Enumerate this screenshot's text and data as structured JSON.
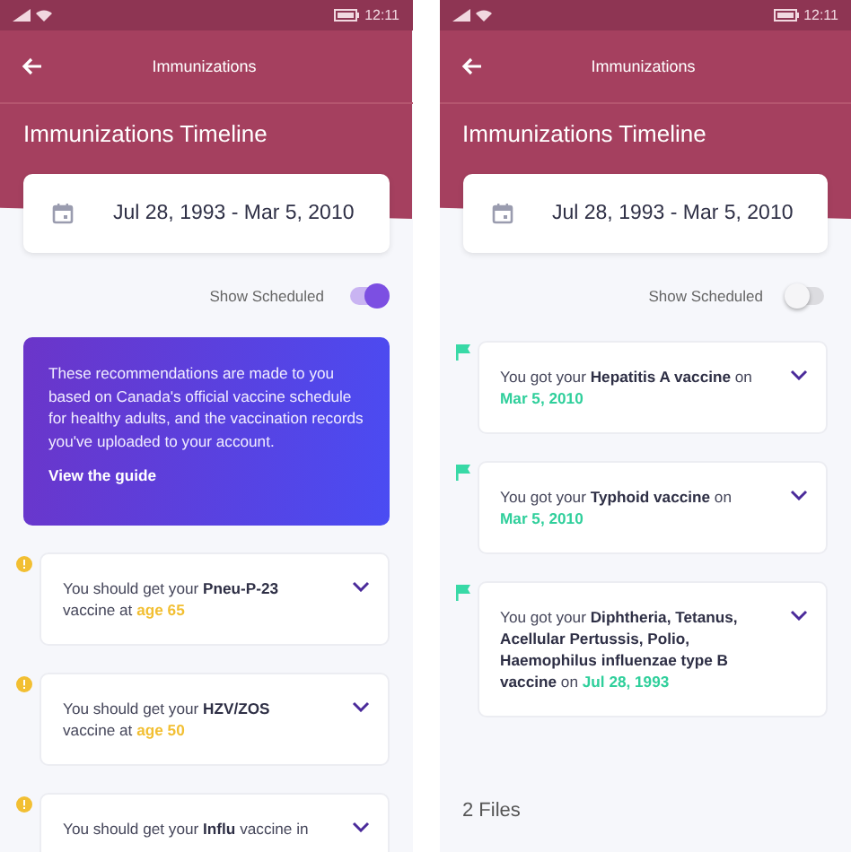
{
  "screens": [
    {
      "status_bar": {
        "time": "12:11"
      },
      "nav": {
        "title": "Immunizations"
      },
      "page_title": "Immunizations Timeline",
      "date_range": "Jul 28, 1993 - Mar 5, 2010",
      "toggle": {
        "label": "Show Scheduled",
        "on": true
      },
      "banner": {
        "text": "These recommendations are made to you based on Canada's official vaccine schedule for healthy adults, and the vaccination records you've uploaded to your account.",
        "link": "View the guide"
      },
      "entries": [
        {
          "kind": "scheduled",
          "text": "You should get your **Pneu-P-23** vaccine at",
          "highlight": "age 65"
        },
        {
          "kind": "scheduled",
          "text": "You should get your **HZV/ZOS** vaccine at",
          "highlight": "age 50"
        },
        {
          "kind": "scheduled",
          "text": "You should get your **Influ** vaccine in"
        }
      ]
    },
    {
      "status_bar": {
        "time": "12:11"
      },
      "nav": {
        "title": "Immunizations"
      },
      "page_title": "Immunizations Timeline",
      "date_range": "Jul 28, 1993 - Mar 5, 2010",
      "toggle": {
        "label": "Show Scheduled",
        "on": false
      },
      "entries": [
        {
          "kind": "received",
          "text": "You got your **Hepatitis A vaccine** on",
          "highlight": "Mar 5, 2010"
        },
        {
          "kind": "received",
          "text": "You got your **Typhoid vaccine** on",
          "highlight": "Mar 5, 2010"
        },
        {
          "kind": "received",
          "text": "You got your **Diphtheria, Tetanus, Acellular Pertussis, Polio, Haemophilus influenzae type B vaccine** on",
          "highlight": "Jul 28, 1993"
        }
      ],
      "footer": "2 Files"
    }
  ]
}
